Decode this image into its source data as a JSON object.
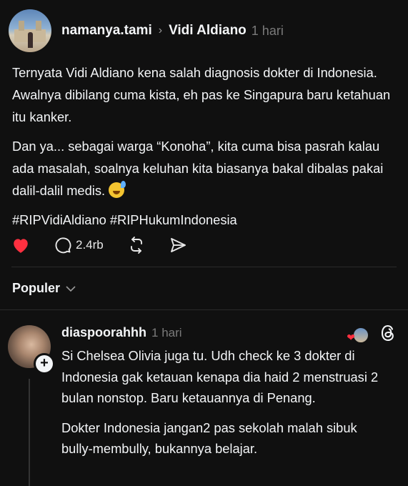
{
  "post": {
    "username": "namanya.tami",
    "reply_to": "Vidi Aldiano",
    "time": "1 hari",
    "paragraph1": "Ternyata Vidi Aldiano kena salah diagnosis dokter di Indonesia. Awalnya dibilang cuma kista, eh pas ke Singapura baru ketahuan itu kanker.",
    "paragraph2": "Dan ya... sebagai warga “Konoha”, kita cuma bisa pasrah kalau ada masalah, soalnya keluhan kita biasanya bakal dibalas pakai dalil-dalil medis.",
    "hashtags": "#RIPVidiAldiano #RIPHukumIndonesia",
    "emoji_icon": "grinning-sweat-emoji"
  },
  "actions": {
    "like_icon": "heart-icon",
    "like_color": "#ff3040",
    "comment_icon": "comment-icon",
    "comment_count": "2.4rb",
    "repost_icon": "repost-icon",
    "share_icon": "share-icon"
  },
  "sort": {
    "label": "Populer",
    "icon": "chevron-down-icon"
  },
  "reply": {
    "username": "diaspoorahhh",
    "time": "1 hari",
    "paragraph1": "Si Chelsea Olivia juga tu. Udh check ke 3 dokter di Indonesia gak ketauan kenapa dia haid 2 menstruasi 2 bulan nonstop.  Baru ketauannya di Penang.",
    "paragraph2": "Dokter Indonesia jangan2 pas sekolah malah sibuk bully-membully, bukannya belajar.",
    "follow_icon": "plus-icon",
    "liked_by_author_icon": "heart-icon",
    "threads_icon": "threads-logo-icon"
  },
  "colors": {
    "background": "#101010",
    "text": "#f3f5f7",
    "muted": "#7a7a7a",
    "like": "#ff3040"
  }
}
